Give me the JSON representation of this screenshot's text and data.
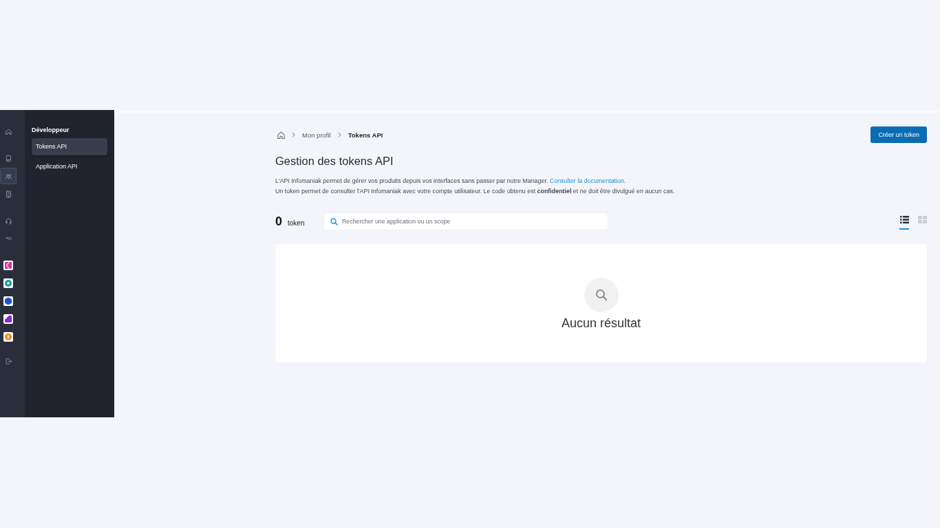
{
  "icon_rail": {
    "nav_items": [
      {
        "selected": false
      },
      {
        "selected": false
      },
      {
        "selected": true
      },
      {
        "selected": false
      },
      {
        "selected": false
      },
      {
        "selected": false
      }
    ],
    "apps": [
      {
        "color": "#c8379f"
      },
      {
        "color": "#12a39b"
      },
      {
        "color": "#1f4fd6"
      },
      {
        "color": "#8a2bd1"
      },
      {
        "color": "#f5861f"
      }
    ]
  },
  "sidebar": {
    "title": "Développeur",
    "items": [
      {
        "label": "Tokens API",
        "selected": true
      },
      {
        "label": "Application API",
        "selected": false
      }
    ]
  },
  "breadcrumb": {
    "items": [
      {
        "label": "Mon profil",
        "current": false
      },
      {
        "label": "Tokens API",
        "current": true
      }
    ]
  },
  "create_button": "Créer un token",
  "title": "Gestion des tokens API",
  "description": [
    {
      "text": "L'API Infomaniak permet de gérer vos produits depuis vos interfaces sans passer par notre Manager.",
      "link": "Consulter la documentation."
    },
    {
      "text": "Un token permet de consulter l'API Infomaniak avec votre compte utilisateur. Le code obtenu est **confidentiel** et ne doit être divulgué en aucun cas."
    }
  ],
  "token_count": {
    "value": "0",
    "unit": "token"
  },
  "search": {
    "placeholder": "Rechercher une application ou un scope"
  },
  "view_toggle": [
    {
      "selected": true
    },
    {
      "selected": false
    }
  ],
  "empty_state": {
    "message": "Aucun résultat"
  }
}
